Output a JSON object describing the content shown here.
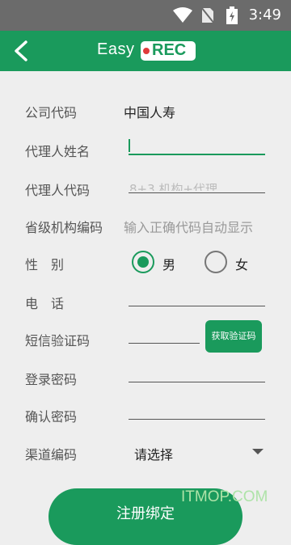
{
  "status_bar": {
    "time": "3:49",
    "icons": [
      "wifi-icon",
      "no-sim-icon",
      "battery-charging-icon"
    ]
  },
  "app_bar": {
    "back_icon": "chevron-left-icon",
    "logo_easy": "Easy",
    "logo_rec": "REC"
  },
  "form": {
    "company_code": {
      "label": "公司代码",
      "value": "中国人寿"
    },
    "agent_name": {
      "label": "代理人姓名",
      "value": ""
    },
    "agent_code": {
      "label": "代理人代码",
      "placeholder": "8+3.机构+代理"
    },
    "province_org_code": {
      "label": "省级机构编码",
      "hint": "输入正确代码自动显示"
    },
    "gender": {
      "label": "性　别",
      "options": [
        "男",
        "女"
      ],
      "selected": "男"
    },
    "phone": {
      "label": "电　话",
      "value": ""
    },
    "sms_code": {
      "label": "短信验证码",
      "value": "",
      "button": "获取验证码"
    },
    "login_password": {
      "label": "登录密码",
      "value": ""
    },
    "confirm_password": {
      "label": "确认密码",
      "value": ""
    },
    "channel_code": {
      "label": "渠道编码",
      "selected": "请选择"
    }
  },
  "submit_label": "注册绑定",
  "watermark": "ITMOP.COM",
  "colors": {
    "accent": "#1a9a5c",
    "status_bar": "#6b6b6b",
    "background": "#eeeeee"
  }
}
